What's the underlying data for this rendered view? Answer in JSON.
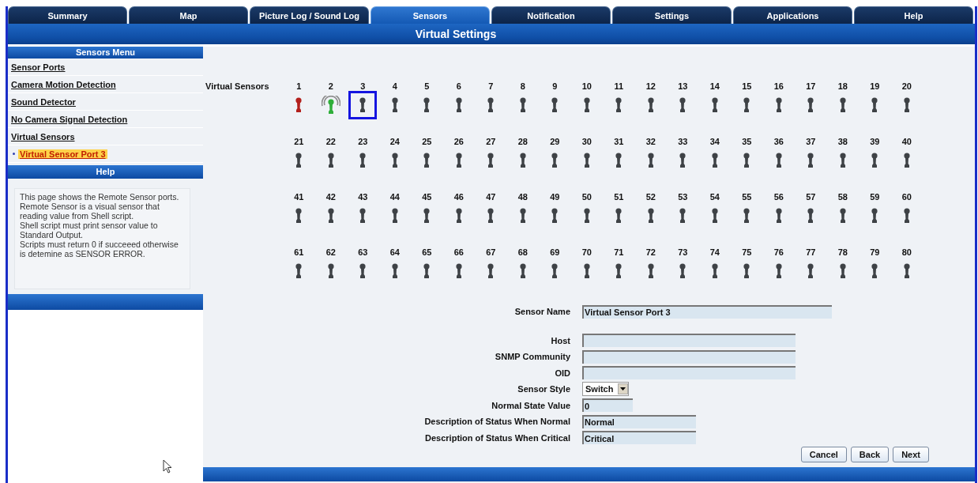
{
  "tabs": [
    {
      "label": "Summary",
      "selected": false
    },
    {
      "label": "Map",
      "selected": false
    },
    {
      "label": "Picture Log / Sound Log",
      "selected": false
    },
    {
      "label": "Sensors",
      "selected": true
    },
    {
      "label": "Notification",
      "selected": false
    },
    {
      "label": "Settings",
      "selected": false
    },
    {
      "label": "Applications",
      "selected": false
    },
    {
      "label": "Help",
      "selected": false
    }
  ],
  "page_title": "Virtual Settings",
  "sidebar": {
    "menu_title": "Sensors Menu",
    "items": [
      {
        "label": "Sensor Ports",
        "selected": false
      },
      {
        "label": "Camera Motion Detection",
        "selected": false
      },
      {
        "label": "Sound Detector",
        "selected": false
      },
      {
        "label": "No Camera Signal Detection",
        "selected": false
      },
      {
        "label": "Virtual Sensors",
        "selected": false,
        "children": [
          {
            "label": "Virtual Sensor Port 3",
            "selected": true
          }
        ]
      }
    ],
    "help_title": "Help",
    "help_text": "This page shows the Remote Sensor ports. Remote Sensor is a visual sensor that reading value from Shell script.\nShell script must print sensor value to Standard Output.\nScripts must return 0 if succeeed otherwise is detemine as SENSOR ERROR."
  },
  "sensors_label": "Virtual Sensors",
  "sensors": [
    {
      "number": "1",
      "color": "#b3201c",
      "signal": false,
      "selected": false
    },
    {
      "number": "2",
      "color": "#2fae3a",
      "signal": true,
      "selected": false
    },
    {
      "number": "3",
      "color": "#3e4246",
      "signal": false,
      "selected": true
    },
    {
      "number": "4",
      "color": "#3e4246",
      "signal": false,
      "selected": false
    },
    {
      "number": "5",
      "color": "#3e4246",
      "signal": false,
      "selected": false
    },
    {
      "number": "6",
      "color": "#3e4246",
      "signal": false,
      "selected": false
    },
    {
      "number": "7",
      "color": "#3e4246",
      "signal": false,
      "selected": false
    },
    {
      "number": "8",
      "color": "#3e4246",
      "signal": false,
      "selected": false
    },
    {
      "number": "9",
      "color": "#3e4246",
      "signal": false,
      "selected": false
    },
    {
      "number": "10",
      "color": "#3e4246",
      "signal": false,
      "selected": false
    },
    {
      "number": "11",
      "color": "#3e4246",
      "signal": false,
      "selected": false
    },
    {
      "number": "12",
      "color": "#3e4246",
      "signal": false,
      "selected": false
    },
    {
      "number": "13",
      "color": "#3e4246",
      "signal": false,
      "selected": false
    },
    {
      "number": "14",
      "color": "#3e4246",
      "signal": false,
      "selected": false
    },
    {
      "number": "15",
      "color": "#3e4246",
      "signal": false,
      "selected": false
    },
    {
      "number": "16",
      "color": "#3e4246",
      "signal": false,
      "selected": false
    },
    {
      "number": "17",
      "color": "#3e4246",
      "signal": false,
      "selected": false
    },
    {
      "number": "18",
      "color": "#3e4246",
      "signal": false,
      "selected": false
    },
    {
      "number": "19",
      "color": "#3e4246",
      "signal": false,
      "selected": false
    },
    {
      "number": "20",
      "color": "#3e4246",
      "signal": false,
      "selected": false
    },
    {
      "number": "21",
      "color": "#3e4246",
      "signal": false,
      "selected": false
    },
    {
      "number": "22",
      "color": "#3e4246",
      "signal": false,
      "selected": false
    },
    {
      "number": "23",
      "color": "#3e4246",
      "signal": false,
      "selected": false
    },
    {
      "number": "24",
      "color": "#3e4246",
      "signal": false,
      "selected": false
    },
    {
      "number": "25",
      "color": "#3e4246",
      "signal": false,
      "selected": false
    },
    {
      "number": "26",
      "color": "#3e4246",
      "signal": false,
      "selected": false
    },
    {
      "number": "27",
      "color": "#3e4246",
      "signal": false,
      "selected": false
    },
    {
      "number": "28",
      "color": "#3e4246",
      "signal": false,
      "selected": false
    },
    {
      "number": "29",
      "color": "#3e4246",
      "signal": false,
      "selected": false
    },
    {
      "number": "30",
      "color": "#3e4246",
      "signal": false,
      "selected": false
    },
    {
      "number": "31",
      "color": "#3e4246",
      "signal": false,
      "selected": false
    },
    {
      "number": "32",
      "color": "#3e4246",
      "signal": false,
      "selected": false
    },
    {
      "number": "33",
      "color": "#3e4246",
      "signal": false,
      "selected": false
    },
    {
      "number": "34",
      "color": "#3e4246",
      "signal": false,
      "selected": false
    },
    {
      "number": "35",
      "color": "#3e4246",
      "signal": false,
      "selected": false
    },
    {
      "number": "36",
      "color": "#3e4246",
      "signal": false,
      "selected": false
    },
    {
      "number": "37",
      "color": "#3e4246",
      "signal": false,
      "selected": false
    },
    {
      "number": "38",
      "color": "#3e4246",
      "signal": false,
      "selected": false
    },
    {
      "number": "39",
      "color": "#3e4246",
      "signal": false,
      "selected": false
    },
    {
      "number": "40",
      "color": "#3e4246",
      "signal": false,
      "selected": false
    },
    {
      "number": "41",
      "color": "#3e4246",
      "signal": false,
      "selected": false
    },
    {
      "number": "42",
      "color": "#3e4246",
      "signal": false,
      "selected": false
    },
    {
      "number": "43",
      "color": "#3e4246",
      "signal": false,
      "selected": false
    },
    {
      "number": "44",
      "color": "#3e4246",
      "signal": false,
      "selected": false
    },
    {
      "number": "45",
      "color": "#3e4246",
      "signal": false,
      "selected": false
    },
    {
      "number": "46",
      "color": "#3e4246",
      "signal": false,
      "selected": false
    },
    {
      "number": "47",
      "color": "#3e4246",
      "signal": false,
      "selected": false
    },
    {
      "number": "48",
      "color": "#3e4246",
      "signal": false,
      "selected": false
    },
    {
      "number": "49",
      "color": "#3e4246",
      "signal": false,
      "selected": false
    },
    {
      "number": "50",
      "color": "#3e4246",
      "signal": false,
      "selected": false
    },
    {
      "number": "51",
      "color": "#3e4246",
      "signal": false,
      "selected": false
    },
    {
      "number": "52",
      "color": "#3e4246",
      "signal": false,
      "selected": false
    },
    {
      "number": "53",
      "color": "#3e4246",
      "signal": false,
      "selected": false
    },
    {
      "number": "54",
      "color": "#3e4246",
      "signal": false,
      "selected": false
    },
    {
      "number": "55",
      "color": "#3e4246",
      "signal": false,
      "selected": false
    },
    {
      "number": "56",
      "color": "#3e4246",
      "signal": false,
      "selected": false
    },
    {
      "number": "57",
      "color": "#3e4246",
      "signal": false,
      "selected": false
    },
    {
      "number": "58",
      "color": "#3e4246",
      "signal": false,
      "selected": false
    },
    {
      "number": "59",
      "color": "#3e4246",
      "signal": false,
      "selected": false
    },
    {
      "number": "60",
      "color": "#3e4246",
      "signal": false,
      "selected": false
    },
    {
      "number": "61",
      "color": "#3e4246",
      "signal": false,
      "selected": false
    },
    {
      "number": "62",
      "color": "#3e4246",
      "signal": false,
      "selected": false
    },
    {
      "number": "63",
      "color": "#3e4246",
      "signal": false,
      "selected": false
    },
    {
      "number": "64",
      "color": "#3e4246",
      "signal": false,
      "selected": false
    },
    {
      "number": "65",
      "color": "#3e4246",
      "signal": false,
      "selected": false
    },
    {
      "number": "66",
      "color": "#3e4246",
      "signal": false,
      "selected": false
    },
    {
      "number": "67",
      "color": "#3e4246",
      "signal": false,
      "selected": false
    },
    {
      "number": "68",
      "color": "#3e4246",
      "signal": false,
      "selected": false
    },
    {
      "number": "69",
      "color": "#3e4246",
      "signal": false,
      "selected": false
    },
    {
      "number": "70",
      "color": "#3e4246",
      "signal": false,
      "selected": false
    },
    {
      "number": "71",
      "color": "#3e4246",
      "signal": false,
      "selected": false
    },
    {
      "number": "72",
      "color": "#3e4246",
      "signal": false,
      "selected": false
    },
    {
      "number": "73",
      "color": "#3e4246",
      "signal": false,
      "selected": false
    },
    {
      "number": "74",
      "color": "#3e4246",
      "signal": false,
      "selected": false
    },
    {
      "number": "75",
      "color": "#3e4246",
      "signal": false,
      "selected": false
    },
    {
      "number": "76",
      "color": "#3e4246",
      "signal": false,
      "selected": false
    },
    {
      "number": "77",
      "color": "#3e4246",
      "signal": false,
      "selected": false
    },
    {
      "number": "78",
      "color": "#3e4246",
      "signal": false,
      "selected": false
    },
    {
      "number": "79",
      "color": "#3e4246",
      "signal": false,
      "selected": false
    },
    {
      "number": "80",
      "color": "#3e4246",
      "signal": false,
      "selected": false
    }
  ],
  "form": {
    "groups": [
      [
        {
          "label": "Sensor Name",
          "kind": "text",
          "value": "Virtual Sensor Port 3"
        }
      ],
      [
        {
          "label": "Host",
          "kind": "text"
        },
        {
          "label": "SNMP Community",
          "kind": "text"
        },
        {
          "label": "OID",
          "kind": "text"
        },
        {
          "label": "Sensor Style",
          "kind": "select",
          "value": "Switch"
        },
        {
          "label": "Normal State Value",
          "kind": "text",
          "value": "0"
        },
        {
          "label": "Description of Status When Normal",
          "kind": "text",
          "value": "Normal"
        },
        {
          "label": "Description of Status When Critical",
          "kind": "text",
          "value": "Critical"
        }
      ]
    ],
    "buttons": [
      "Cancel",
      "Back",
      "Next"
    ]
  }
}
